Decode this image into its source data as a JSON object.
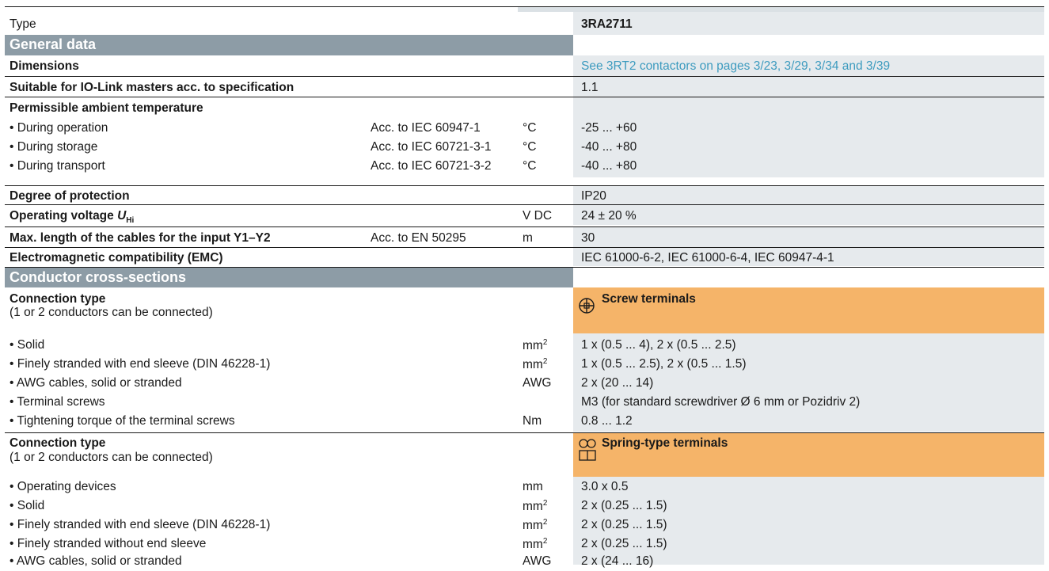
{
  "header": {
    "type_label": "Type",
    "type_value": "3RA2711"
  },
  "sections": {
    "general": "General data",
    "conductor": "Conductor cross-sections"
  },
  "general_rows": {
    "dimensions": {
      "label": "Dimensions",
      "value": "See 3RT2 contactors on pages 3/23, 3/29, 3/34 and 3/39"
    },
    "io_link": {
      "label": "Suitable for IO-Link masters acc. to specification",
      "value": "1.1"
    },
    "ambient": {
      "label": "Permissible ambient temperature"
    },
    "op": {
      "label": "• During operation",
      "standard": "Acc. to IEC 60947-1",
      "unit": "°C",
      "value": "-25 ... +60"
    },
    "storage": {
      "label": "• During storage",
      "standard": "Acc. to IEC 60721-3-1",
      "unit": "°C",
      "value": "-40 ... +80"
    },
    "transport": {
      "label": "• During transport",
      "standard": "Acc. to IEC 60721-3-2",
      "unit": "°C",
      "value": "-40 ... +80"
    },
    "protection": {
      "label": "Degree of protection",
      "value": "IP20"
    },
    "voltage": {
      "label": "Operating voltage ",
      "symbol": "U",
      "subscript": "Hi",
      "unit": "V DC",
      "value": "24 ± 20 %"
    },
    "cable": {
      "label": "Max. length of the cables for the input Y1–Y2",
      "standard": "Acc. to EN 50295",
      "unit": "m",
      "value": "30"
    },
    "emc": {
      "label": "Electromagnetic compatibility (EMC)",
      "value": "IEC 61000-6-2, IEC 61000-6-4, IEC 60947-4-1"
    }
  },
  "screw": {
    "conn_label": "Connection type",
    "conn_note": "(1 or 2 conductors can be connected)",
    "terminal_title": "Screw terminals",
    "rows": [
      {
        "label": "• Solid",
        "unit": "mm",
        "sup": "2",
        "value": "1 x (0.5 ... 4), 2 x (0.5 ... 2.5)"
      },
      {
        "label": "• Finely stranded with end sleeve (DIN 46228-1)",
        "unit": "mm",
        "sup": "2",
        "value": "1 x (0.5 ... 2.5), 2 x (0.5 ... 1.5)"
      },
      {
        "label": "• AWG cables, solid or stranded",
        "unit": "AWG",
        "sup": "",
        "value": "2 x (20 ... 14)"
      },
      {
        "label": "• Terminal screws",
        "unit": "",
        "sup": "",
        "value": "M3 (for standard screwdriver Ø 6 mm or Pozidriv 2)"
      },
      {
        "label": "• Tightening torque of the terminal screws",
        "unit": "Nm",
        "sup": "",
        "value": "0.8 ... 1.2"
      }
    ]
  },
  "spring": {
    "conn_label": "Connection type",
    "conn_note": "(1 or 2 conductors can be connected)",
    "terminal_title": "Spring-type terminals",
    "rows": [
      {
        "label": "• Operating devices",
        "unit": "mm",
        "sup": "",
        "value": "3.0 x 0.5"
      },
      {
        "label": "• Solid",
        "unit": "mm",
        "sup": "2",
        "value": "2 x (0.25 ... 1.5)"
      },
      {
        "label": "• Finely stranded with end sleeve (DIN 46228-1)",
        "unit": "mm",
        "sup": "2",
        "value": "2 x (0.25 ... 1.5)"
      },
      {
        "label": "• Finely stranded without end sleeve",
        "unit": "mm",
        "sup": "2",
        "value": "2 x (0.25 ... 1.5)"
      },
      {
        "label": "• AWG cables, solid or stranded",
        "unit": "AWG",
        "sup": "",
        "value": "2 x (24 ... 16)"
      }
    ]
  },
  "icons": {
    "screw": "screw-terminal-icon",
    "spring": "spring-terminal-icon"
  },
  "colors": {
    "section_header": "#8d9ca6",
    "value_column": "#e6eaed",
    "terminal_highlight": "#f5b469",
    "link": "#3d9bbf"
  }
}
